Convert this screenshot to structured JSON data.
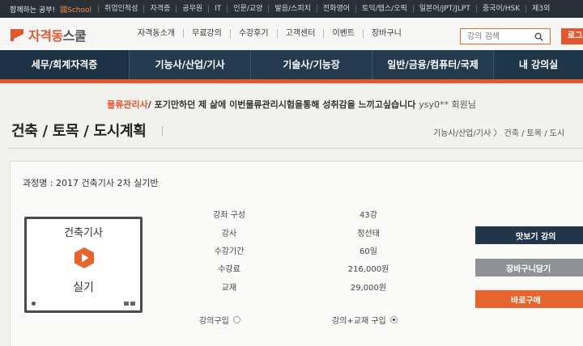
{
  "topbar": {
    "intro": "함께하는 공부!",
    "brand": "國School",
    "items": [
      "취업인적성",
      "자격증",
      "공무원",
      "IT",
      "인문/교양",
      "발음/스피치",
      "전화영어",
      "토익/텝스/오픽",
      "일본어/JPT/JLPT",
      "중국어/HSK",
      "제3외"
    ]
  },
  "header": {
    "logo_main": "자격동",
    "logo_sub": "스쿨",
    "nav": [
      "자격동소개",
      "무료강의",
      "수강후기",
      "고객센터",
      "이벤트",
      "장바구니"
    ],
    "search_placeholder": "강의 검색",
    "login_label": "로그"
  },
  "categories": [
    {
      "label": "세무/회계자격증"
    },
    {
      "label": "기능사/산업/기사"
    },
    {
      "label": "기술사/기능장"
    },
    {
      "label": "일반/금융/컴퓨터/국제"
    },
    {
      "label": "내 강의실"
    }
  ],
  "ticker": {
    "label": "물류관리사",
    "message": "/ 포기만하던 제 삶에 이번물류관리시험을통해 성취감을 느끼고싶습니다",
    "user": "ysy0** 회원님"
  },
  "page": {
    "title": "건축 / 토목 / 도시계획",
    "breadcrumb": "기능사/산업/기사 〉 건축 / 토목 / 도시"
  },
  "course": {
    "name": "과정명 : 2017 건축기사 2차 실기반",
    "thumb_line1": "건축기사",
    "thumb_line2": "실기",
    "details": [
      {
        "label": "강좌 구성",
        "value": "43강"
      },
      {
        "label": "강사",
        "value": "정선태"
      },
      {
        "label": "수강기간",
        "value": "60일"
      },
      {
        "label": "수강료",
        "value": "216,000원"
      },
      {
        "label": "교재",
        "value": "29,000원"
      }
    ],
    "options": [
      {
        "label": "강의구입",
        "checked": false
      },
      {
        "label": "강의+교재 구입",
        "checked": true
      }
    ],
    "buttons": {
      "sample": "맛보기 강의",
      "cart": "장바구니담기",
      "buy": "바로구매"
    }
  },
  "colors": {
    "accent": "#e4572e",
    "nav_bg": "#243a4f",
    "topbar_bg": "#2a3038",
    "cart_btn": "#8e9296",
    "buy_btn": "#e8642e"
  }
}
